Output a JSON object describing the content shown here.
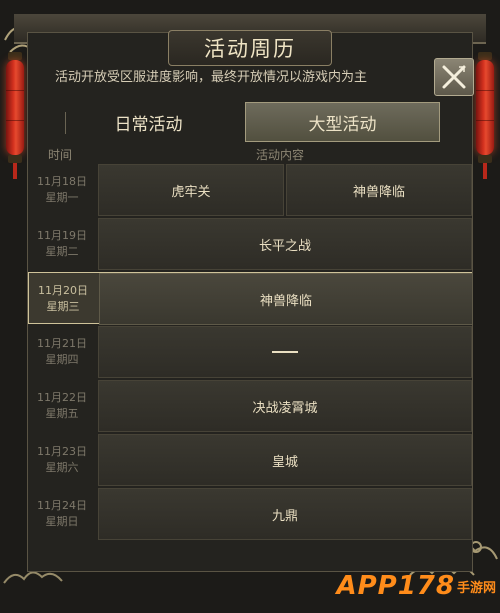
{
  "window": {
    "title": "活动周历",
    "notice": "活动开放受区服进度影响，最终开放情况以游戏内为主"
  },
  "tabs": [
    {
      "label": "日常活动",
      "active": false
    },
    {
      "label": "大型活动",
      "active": true
    }
  ],
  "columns": {
    "time": "时间",
    "content": "活动内容"
  },
  "rows": [
    {
      "date": "11月18日",
      "weekday": "星期一",
      "events": [
        "虎牢关",
        "神兽降临"
      ]
    },
    {
      "date": "11月19日",
      "weekday": "星期二",
      "events": [
        "长平之战"
      ]
    },
    {
      "date": "11月20日",
      "weekday": "星期三",
      "events": [
        "神兽降临"
      ],
      "highlighted": true
    },
    {
      "date": "11月21日",
      "weekday": "星期四",
      "events": [
        "——"
      ]
    },
    {
      "date": "11月22日",
      "weekday": "星期五",
      "events": [
        "决战凌霄城"
      ]
    },
    {
      "date": "11月23日",
      "weekday": "星期六",
      "events": [
        "皇城"
      ]
    },
    {
      "date": "11月24日",
      "weekday": "星期日",
      "events": [
        "九鼎"
      ]
    }
  ],
  "watermark": {
    "main": "APP178",
    "sub": "手游网"
  },
  "colors": {
    "accent_gold": "#cfc39a",
    "lantern_red": "#d2301e",
    "watermark_orange": "#ff8c1a"
  },
  "icons": {
    "close": "close-x-icon",
    "lantern": "lantern-icon",
    "cloud": "auspicious-cloud-icon"
  }
}
